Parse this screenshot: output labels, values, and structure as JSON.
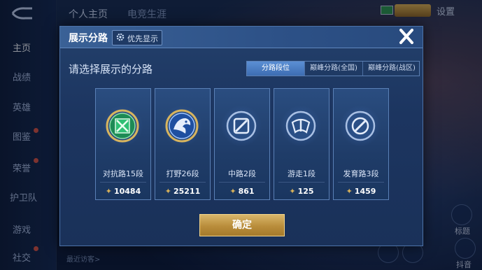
{
  "background": {
    "top_tabs": [
      "个人主页",
      "电竞生涯"
    ],
    "settings_label": "设置",
    "nav_items": [
      "主页",
      "战绩",
      "英雄",
      "图鉴",
      "荣誉",
      "护卫队",
      "游戏",
      "社交"
    ],
    "recent_visitors_label": "最近访客>",
    "side_labels": [
      "标题",
      "抖音"
    ]
  },
  "dialog": {
    "title": "展示分路",
    "priority_label": "优先显示",
    "prompt": "请选择展示的分路",
    "filter_tabs": [
      "分路段位",
      "巅峰分路(全国)",
      "巅峰分路(战区)"
    ],
    "active_filter": "分路段位",
    "lanes": [
      {
        "name": "对抗路15段",
        "score": "10484",
        "icon": "clash-lane-icon"
      },
      {
        "name": "打野26段",
        "score": "25211",
        "icon": "jungle-icon"
      },
      {
        "name": "中路2段",
        "score": "861",
        "icon": "mid-lane-icon"
      },
      {
        "name": "游走1段",
        "score": "125",
        "icon": "roam-icon"
      },
      {
        "name": "发育路3段",
        "score": "1459",
        "icon": "farm-lane-icon"
      }
    ],
    "confirm_label": "确定"
  },
  "colors": {
    "dialog_bg": "#1c3560",
    "accent_blue": "#3d6db2",
    "gold": "#b98d3b",
    "score_star": "#d9b25a"
  }
}
